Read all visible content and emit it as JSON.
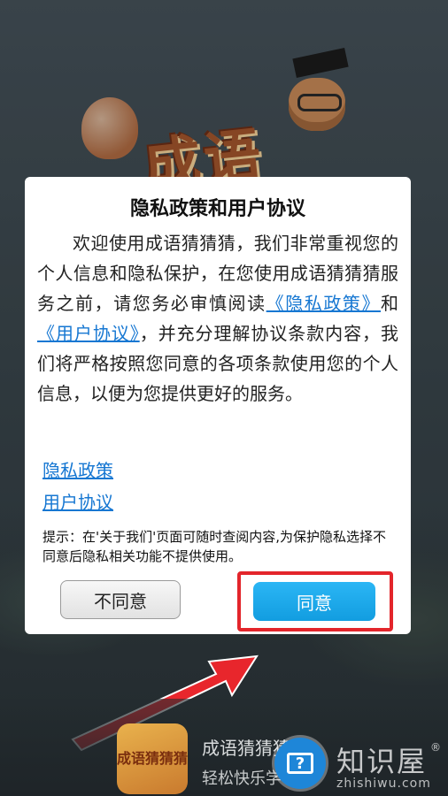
{
  "dialog": {
    "title": "隐私政策和用户协议",
    "body_part1": "欢迎使用成语猜猜猜，我们非常重视您的个人信息和隐私保护，在您使用成语猜猜猜服务之前，请您务必审慎阅读",
    "privacy_link_inline": "《隐私政策》",
    "body_and": "和",
    "agreement_link_inline": "《用户协议》",
    "body_part2": "，并充分理解协议条款内容，我们将严格按照您同意的各项条款使用您的个人信息，以便为您提供更好的服务。",
    "privacy_link": "隐私政策",
    "agreement_link": "用户协议",
    "tip": "提示：在'关于我们'页面可随时查阅内容,为保护隐私选择不同意后隐私相关功能不提供使用。",
    "disagree_label": "不同意",
    "agree_label": "同意"
  },
  "background": {
    "logo_text": "成语"
  },
  "bottom_bar": {
    "app_icon_text": "成语猜猜猜",
    "app_name": "成语猜猜猜",
    "app_subtitle": "轻松快乐学"
  },
  "watermark": {
    "badge_icon": "question-monitor-icon",
    "badge_symbol": "?",
    "title": "知识屋",
    "registered": "®",
    "url": "zhishiwu.com"
  },
  "colors": {
    "link": "#1677d2",
    "agree_button": "#1aa7ea",
    "highlight_border": "#e3252b",
    "arrow": "#e8262c"
  }
}
